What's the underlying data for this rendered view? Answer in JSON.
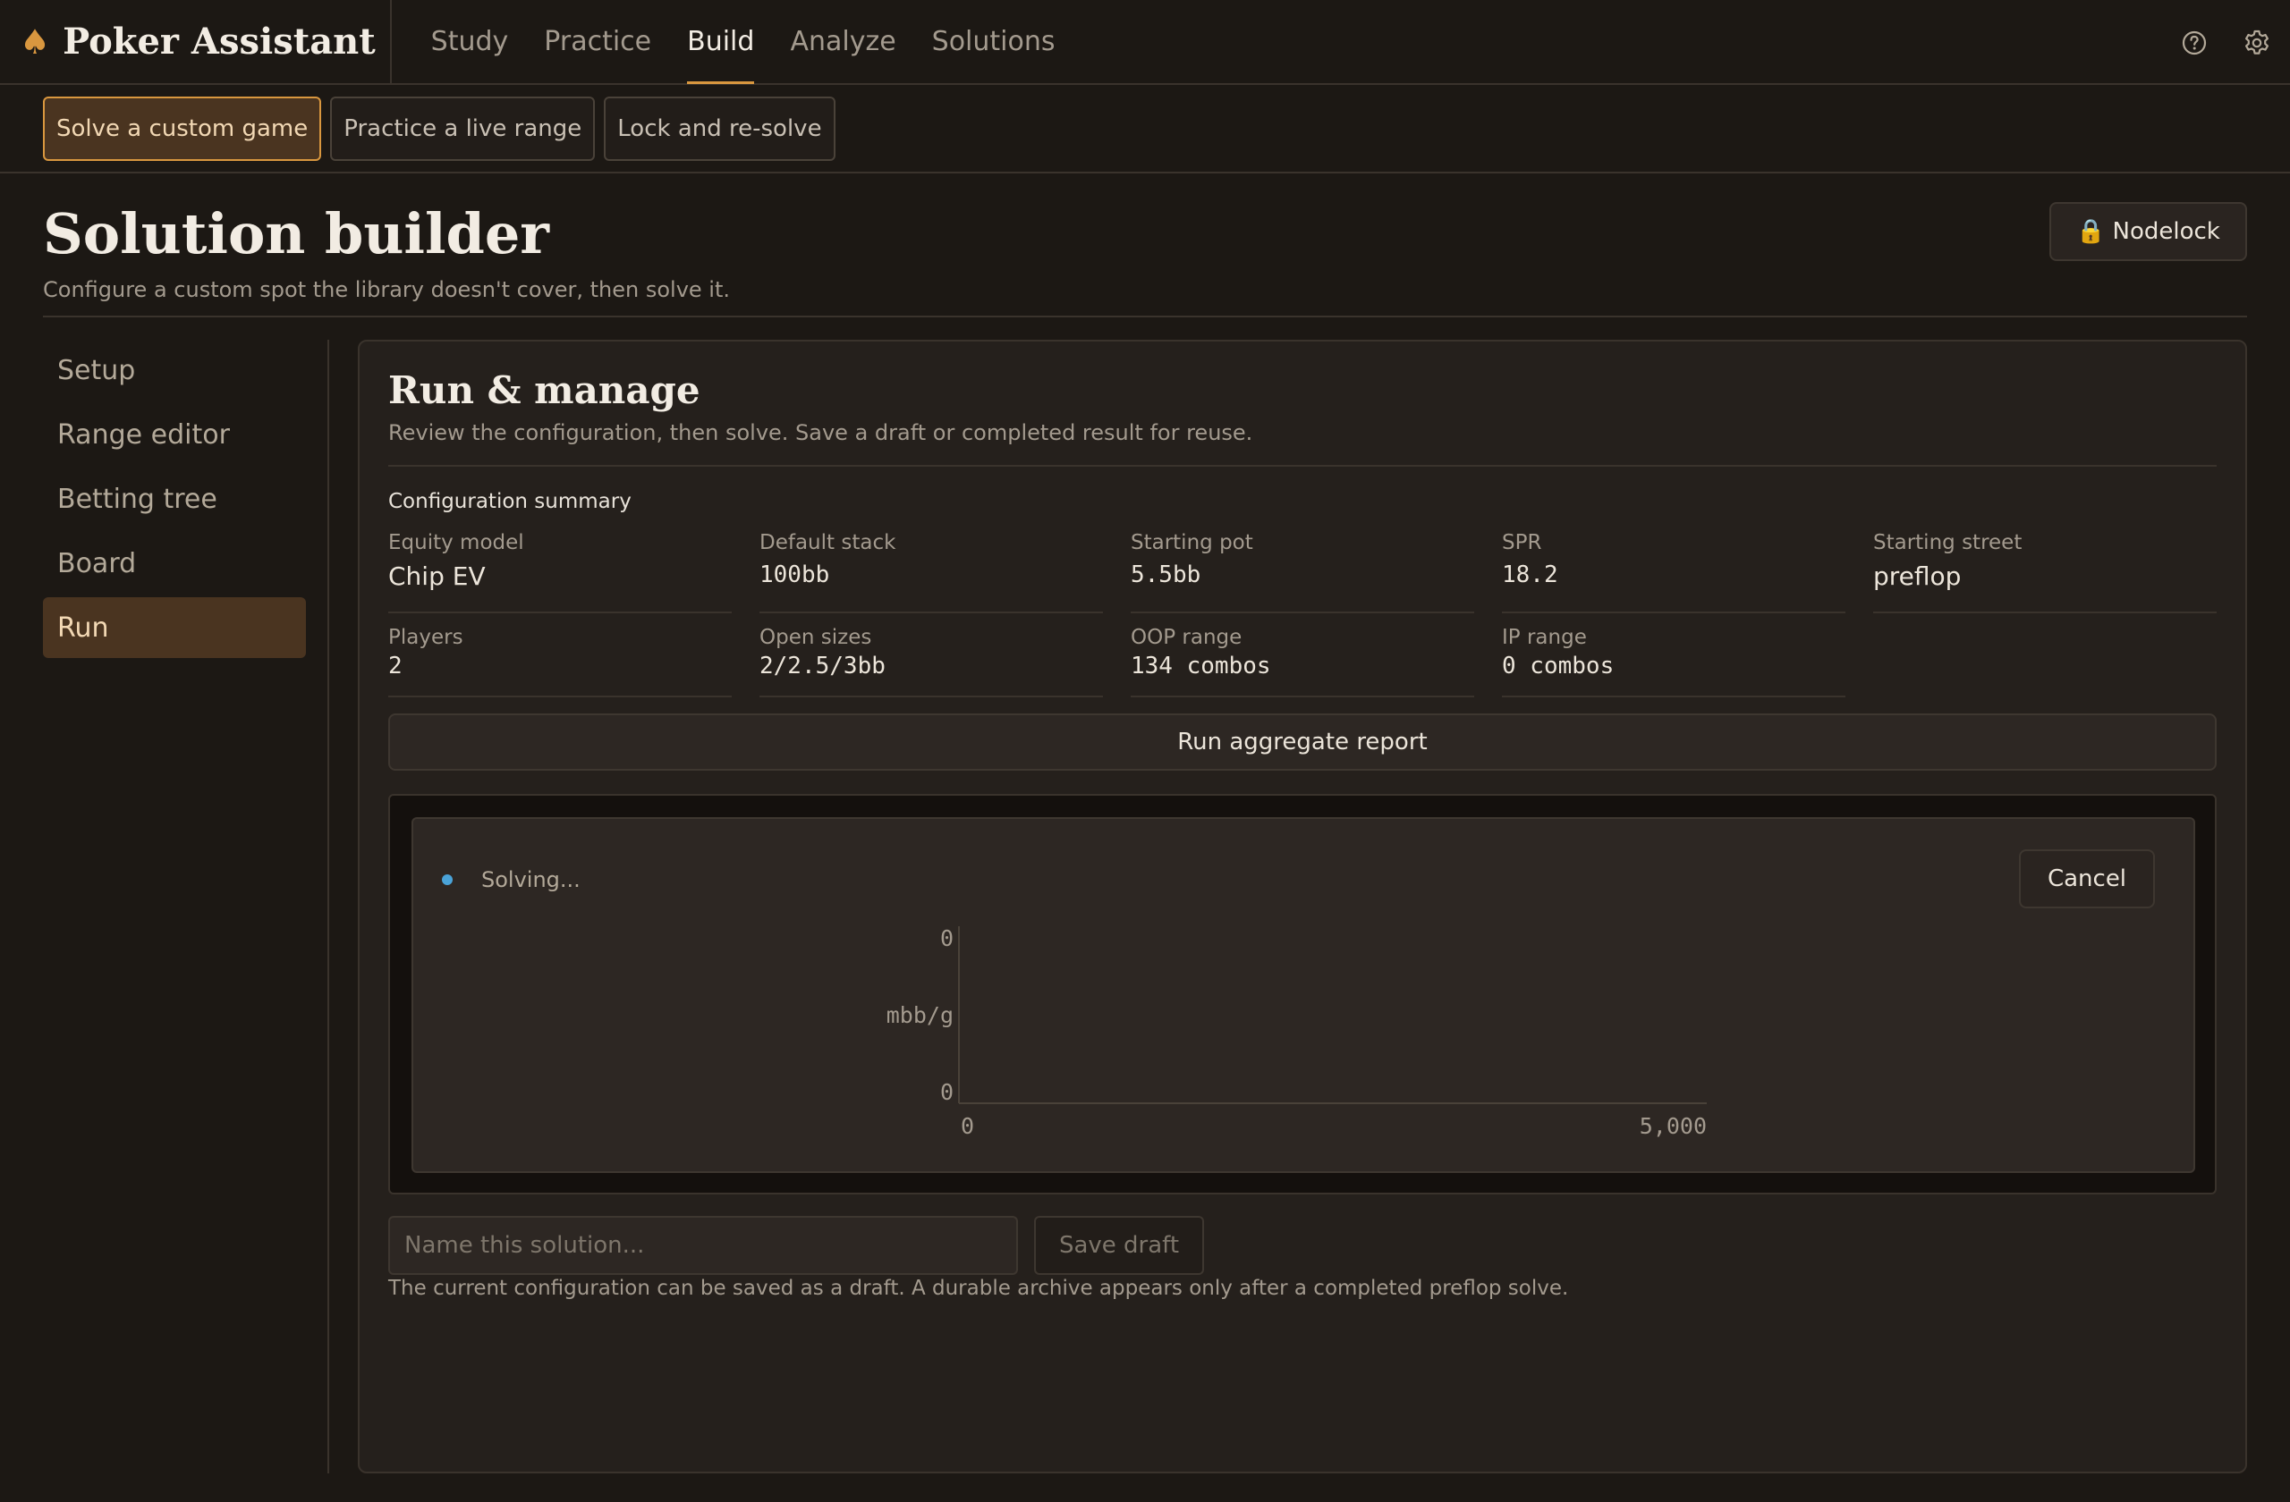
{
  "app": {
    "name": "Poker Assistant",
    "brand_icon": "spade-icon",
    "accent": "#d9973f"
  },
  "nav": {
    "items": [
      {
        "label": "Study",
        "active": false
      },
      {
        "label": "Practice",
        "active": false
      },
      {
        "label": "Build",
        "active": true
      },
      {
        "label": "Analyze",
        "active": false
      },
      {
        "label": "Solutions",
        "active": false
      }
    ],
    "icons": [
      "help-icon",
      "settings-icon"
    ]
  },
  "subtabs": [
    {
      "label": "Solve a custom game",
      "active": true
    },
    {
      "label": "Practice a live range",
      "active": false
    },
    {
      "label": "Lock and re-solve",
      "active": false
    }
  ],
  "header": {
    "title": "Solution builder",
    "subtitle": "Configure a custom spot the library doesn't cover, then solve it.",
    "nodelock_label": "Nodelock",
    "nodelock_icon": "🔒"
  },
  "sidenav": [
    {
      "label": "Setup",
      "active": false
    },
    {
      "label": "Range editor",
      "active": false
    },
    {
      "label": "Betting tree",
      "active": false
    },
    {
      "label": "Board",
      "active": false
    },
    {
      "label": "Run",
      "active": true
    }
  ],
  "panel": {
    "title": "Run & manage",
    "subtitle": "Review the configuration, then solve. Save a draft or completed result for reuse.",
    "summary_title": "Configuration summary",
    "summary": [
      {
        "label": "Equity model",
        "value": "Chip EV",
        "mono": false
      },
      {
        "label": "Default stack",
        "value": "100bb",
        "mono": true
      },
      {
        "label": "Starting pot",
        "value": "5.5bb",
        "mono": true
      },
      {
        "label": "SPR",
        "value": "18.2",
        "mono": true
      },
      {
        "label": "Starting street",
        "value": "preflop",
        "mono": false
      },
      {
        "label": "Players",
        "value": "2",
        "mono": true
      },
      {
        "label": "Open sizes",
        "value": "2/2.5/3bb",
        "mono": true
      },
      {
        "label": "OOP range",
        "value": "134 combos",
        "mono": true
      },
      {
        "label": "IP range",
        "value": "0 combos",
        "mono": true
      }
    ],
    "run_button": "Run aggregate report",
    "status": {
      "text": "Solving...",
      "dot_color": "#4aa3d8"
    },
    "cancel_label": "Cancel",
    "save": {
      "placeholder": "Name this solution...",
      "button": "Save draft",
      "note": "The current configuration can be saved as a draft. A durable archive appears only after a completed preflop solve."
    }
  },
  "chart_data": {
    "type": "line",
    "title": "",
    "xlabel": "",
    "ylabel": "mbb/g",
    "x_ticks": [
      "0",
      "5,000"
    ],
    "y_ticks": [
      "0",
      "0"
    ],
    "xlim": [
      0,
      5000
    ],
    "ylim": [
      0,
      0
    ],
    "series": []
  }
}
